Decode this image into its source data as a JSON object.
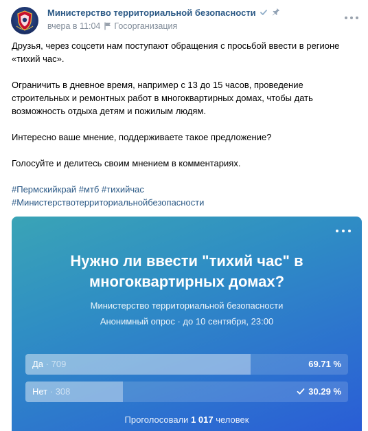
{
  "post": {
    "author": "Министерство территориальной безопасности",
    "time": "вчера в 11:04",
    "category": "Госорганизация",
    "paragraphs": [
      "Друзья, через соцсети нам поступают обращения с просьбой ввести в регионе «тихий час».",
      "Ограничить в дневное время, например с 13 до 15 часов, проведение строительных и ремонтных работ в многоквартирных домах, чтобы дать возможность отдыха детям и пожилым людям.",
      "Интересно ваше мнение, поддерживаете такое предложение?",
      "Голосуйте и делитесь своим мнением в комментариях."
    ],
    "hashtags": [
      "#Пермскийкрай",
      "#мтб",
      "#тихийчас",
      "#Министерствотерриториальнойбезопасности"
    ]
  },
  "poll": {
    "question": "Нужно ли ввести \"тихий час\" в многоквартирных домах?",
    "author": "Министерство территориальной безопасности",
    "info": "Анонимный опрос · до 10 сентября, 23:00",
    "options": [
      {
        "label": "Да",
        "count": "· 709",
        "percent": "69.71 %",
        "fraction": 0.6971,
        "voted": false
      },
      {
        "label": "Нет",
        "count": "· 308",
        "percent": "30.29 %",
        "fraction": 0.3029,
        "voted": true
      }
    ],
    "total_prefix": "Проголосовали",
    "total_count": "1 017",
    "total_suffix": "человек"
  },
  "icons": {
    "verified": "check-icon",
    "pinned": "pin-icon",
    "category": "flag-icon",
    "more": "more-dots-icon"
  },
  "colors": {
    "link": "#2a5885",
    "meta": "#818c99",
    "poll_gradient_start": "#3aa4b6",
    "poll_gradient_end": "#2a5cd6"
  }
}
